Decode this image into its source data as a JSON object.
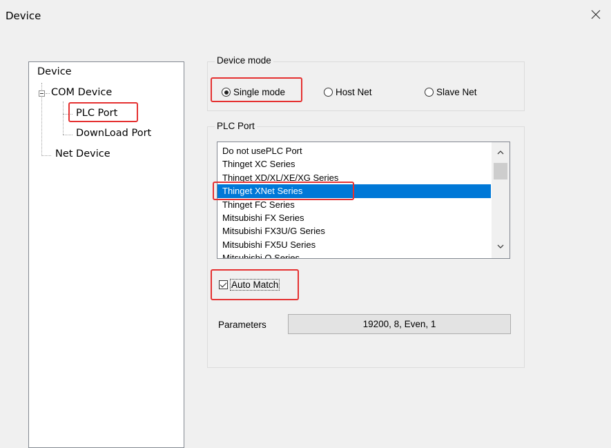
{
  "window": {
    "title": "Device",
    "close_glyph": "✕"
  },
  "tree": {
    "root": "Device",
    "com_device": "COM Device",
    "plc_port": "PLC Port",
    "download_port": "DownLoad Port",
    "net_device": "Net Device"
  },
  "device_mode": {
    "group_label": "Device mode",
    "options": [
      "Single mode",
      "Host Net",
      "Slave Net"
    ],
    "selected": "Single mode"
  },
  "plc_port": {
    "group_label": "PLC Port",
    "items": [
      "Do not usePLC Port",
      "Thinget XC Series",
      "Thinget XD/XL/XE/XG Series",
      "Thinget XNet Series",
      "Thinget FC Series",
      "Mitsubishi FX Series",
      "Mitsubishi FX3U/G Series",
      "Mitsubishi FX5U Series",
      "Mitsubishi Q Series"
    ],
    "selected": "Thinget XNet Series",
    "scroll_up": "▲",
    "scroll_down": "▼"
  },
  "auto_match": {
    "label": "Auto Match",
    "checked": true
  },
  "parameters": {
    "label": "Parameters",
    "value": "19200, 8, Even, 1"
  },
  "highlight_color": "#e53030",
  "selection_color": "#0078d7"
}
